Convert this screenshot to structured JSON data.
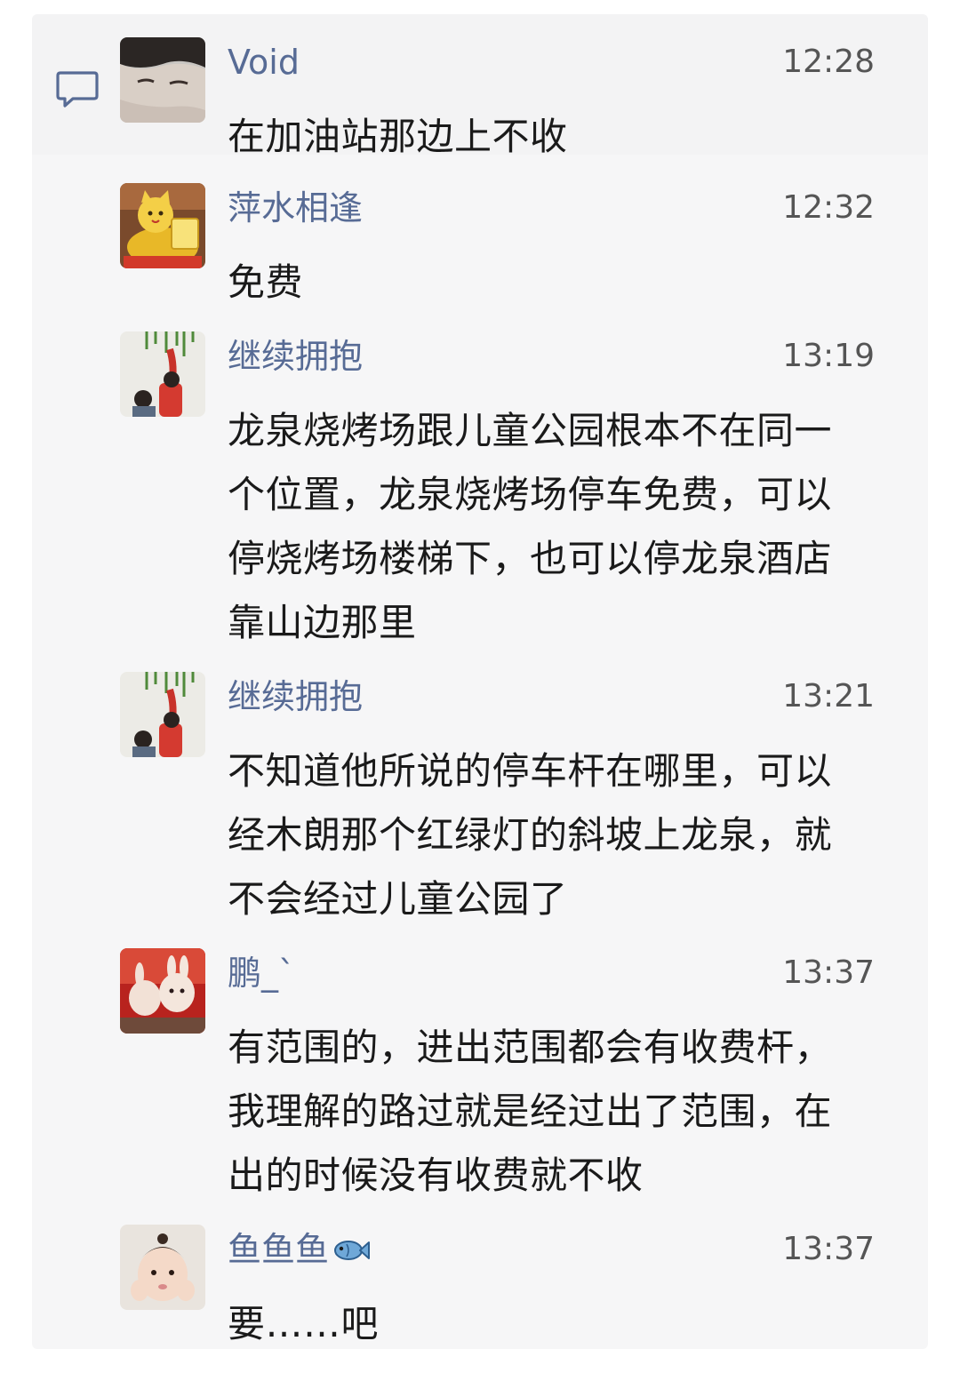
{
  "messages": [
    {
      "name": "Void",
      "time": "12:28",
      "lines": [
        "在加油站那边上不收"
      ],
      "avatar": "young-man-avatar"
    },
    {
      "name": "萍水相逢",
      "time": "12:32",
      "lines": [
        "免费"
      ],
      "avatar": "lucky-cat-avatar"
    },
    {
      "name": "继续拥抱",
      "time": "13:19",
      "lines": [
        "龙泉烧烤场跟儿童公园根本不在同一",
        "个位置，龙泉烧烤场停车免费，可以",
        "停烧烤场楼梯下，也可以停龙泉酒店",
        "靠山边那里"
      ],
      "avatar": "child-wall-avatar"
    },
    {
      "name": "继续拥抱",
      "time": "13:21",
      "lines": [
        "不知道他所说的停车杆在哪里，可以",
        "经木朗那个红绿灯的斜坡上龙泉，就",
        "不会经过儿童公园了"
      ],
      "avatar": "child-wall-avatar"
    },
    {
      "name": "鹏_`",
      "time": "13:37",
      "lines": [
        "有范围的，进出范围都会有收费杆，",
        "我理解的路过就是经过出了范围，在",
        "出的时候没有收费就不收"
      ],
      "avatar": "rabbit-figures-avatar"
    },
    {
      "name": "鱼鱼鱼",
      "time": "13:37",
      "lines": [
        "要……吧"
      ],
      "avatar": "baby-avatar",
      "name_emoji": "fish-emoji-icon"
    }
  ],
  "colors": {
    "name": "#576b95",
    "time": "#555555",
    "text": "#1a1a1a",
    "panel": "#f6f6f7"
  }
}
